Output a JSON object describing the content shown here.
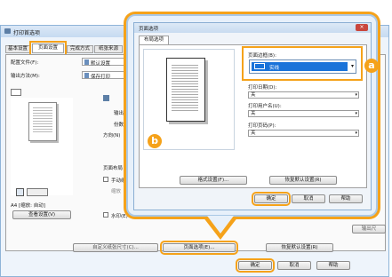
{
  "main_window": {
    "title": "打印首选项",
    "tabs": [
      "基本设置",
      "页面设置",
      "完成方式",
      "纸张来源",
      "质"
    ],
    "left_labels": {
      "profile": "配置文件(F):",
      "output_method": "输出方法(M):"
    },
    "default_settings": "默认设置",
    "print_option": "保存打印",
    "size_text": "A4 [缩放: 自动]",
    "view_settings_button": "查看设置(V)",
    "fragments": [
      "输出",
      "份数",
      "方向(N)",
      "页面布局",
      "手动缩",
      "缩放",
      "水印(E)",
      "自定义纸张尺寸(C)..."
    ],
    "output_btn": "输出尺",
    "page_options_button": "页面选项(E)...",
    "restore_defaults_button": "恢复默认设置(R)",
    "ok_button": "确定",
    "cancel_button": "取消",
    "help_button": "帮助"
  },
  "dialog": {
    "title": "页面选项",
    "tab": "布局选项",
    "page_border": {
      "label": "页面边框(B):",
      "value": "实线"
    },
    "print_date": {
      "label": "打印日期(D):",
      "value": "关"
    },
    "print_user": {
      "label": "打印用户名(U):",
      "value": "关"
    },
    "print_page_number": {
      "label": "打印页码(P):",
      "value": "关"
    },
    "format_settings_button": "格式设置(F)...",
    "restore_defaults_button": "恢复默认设置(R)",
    "ok_button": "确定",
    "cancel_button": "取消",
    "help_button": "帮助"
  },
  "badges": {
    "a": "a",
    "b": "b"
  },
  "colors": {
    "highlight": "#f5a21a",
    "dialog_border": "#a9c8e6",
    "selected_blue": "#1a73d9"
  }
}
